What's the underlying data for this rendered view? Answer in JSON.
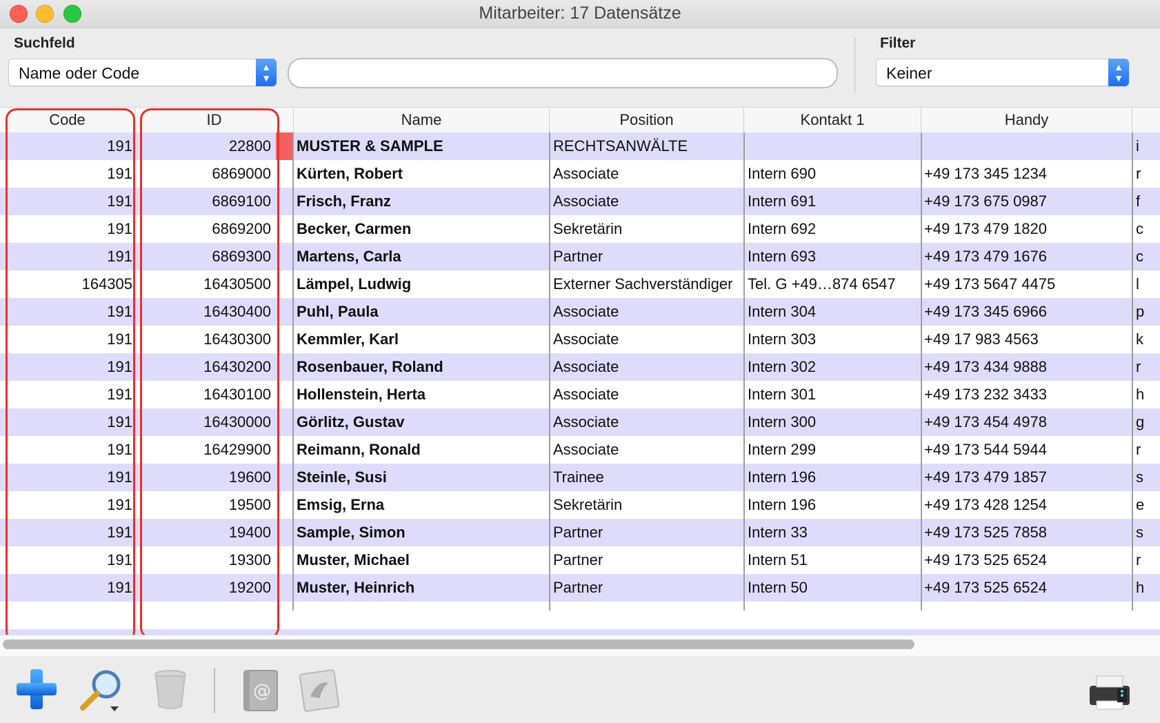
{
  "window": {
    "title": "Mitarbeiter: 17 Datensätze"
  },
  "search": {
    "field_label": "Suchfeld",
    "field_select": "Name oder Code",
    "query": "",
    "filter_label": "Filter",
    "filter_select": "Keiner"
  },
  "table": {
    "columns": [
      "Code",
      "ID",
      "Name",
      "Position",
      "Kontakt 1",
      "Handy"
    ],
    "rows": [
      {
        "code": "191",
        "id": "22800",
        "name": "MUSTER & SAMPLE",
        "position": "RECHTSANWÄLTE",
        "kontakt1": "",
        "handy": "",
        "extra": "i"
      },
      {
        "code": "191",
        "id": "6869000",
        "name": "Kürten, Robert",
        "position": "Associate",
        "kontakt1": "Intern 690",
        "handy": "+49 173 345 1234",
        "extra": "r"
      },
      {
        "code": "191",
        "id": "6869100",
        "name": "Frisch, Franz",
        "position": "Associate",
        "kontakt1": "Intern 691",
        "handy": "+49 173 675 0987",
        "extra": "f"
      },
      {
        "code": "191",
        "id": "6869200",
        "name": "Becker, Carmen",
        "position": "Sekretärin",
        "kontakt1": "Intern 692",
        "handy": "+49 173 479 1820",
        "extra": "c"
      },
      {
        "code": "191",
        "id": "6869300",
        "name": "Martens, Carla",
        "position": "Partner",
        "kontakt1": "Intern 693",
        "handy": "+49 173 479 1676",
        "extra": "c"
      },
      {
        "code": "164305",
        "id": "16430500",
        "name": "Lämpel, Ludwig",
        "position": "Externer Sachverständiger",
        "kontakt1": "Tel. G +49…874 6547",
        "handy": "+49 173 5647 4475",
        "extra": "l"
      },
      {
        "code": "191",
        "id": "16430400",
        "name": "Puhl, Paula",
        "position": "Associate",
        "kontakt1": "Intern 304",
        "handy": "+49 173 345 6966",
        "extra": "p"
      },
      {
        "code": "191",
        "id": "16430300",
        "name": "Kemmler, Karl",
        "position": "Associate",
        "kontakt1": "Intern 303",
        "handy": "+49 17 983 4563",
        "extra": "k"
      },
      {
        "code": "191",
        "id": "16430200",
        "name": "Rosenbauer, Roland",
        "position": "Associate",
        "kontakt1": "Intern 302",
        "handy": "+49 173 434 9888",
        "extra": "r"
      },
      {
        "code": "191",
        "id": "16430100",
        "name": "Hollenstein, Herta",
        "position": "Associate",
        "kontakt1": "Intern 301",
        "handy": "+49 173 232 3433",
        "extra": "h"
      },
      {
        "code": "191",
        "id": "16430000",
        "name": "Görlitz, Gustav",
        "position": "Associate",
        "kontakt1": "Intern 300",
        "handy": "+49 173 454 4978",
        "extra": "g"
      },
      {
        "code": "191",
        "id": "16429900",
        "name": "Reimann, Ronald",
        "position": "Associate",
        "kontakt1": "Intern 299",
        "handy": "+49 173 544 5944",
        "extra": "r"
      },
      {
        "code": "191",
        "id": "19600",
        "name": "Steinle, Susi",
        "position": "Trainee",
        "kontakt1": "Intern 196",
        "handy": "+49 173 479 1857",
        "extra": "s"
      },
      {
        "code": "191",
        "id": "19500",
        "name": "Emsig, Erna",
        "position": "Sekretärin",
        "kontakt1": "Intern 196",
        "handy": "+49 173 428 1254",
        "extra": "e"
      },
      {
        "code": "191",
        "id": "19400",
        "name": "Sample, Simon",
        "position": "Partner",
        "kontakt1": "Intern 33",
        "handy": "+49 173 525 7858",
        "extra": "s"
      },
      {
        "code": "191",
        "id": "19300",
        "name": "Muster, Michael",
        "position": "Partner",
        "kontakt1": "Intern 51",
        "handy": "+49 173 525 6524",
        "extra": "r"
      },
      {
        "code": "191",
        "id": "19200",
        "name": "Muster, Heinrich",
        "position": "Partner",
        "kontakt1": "Intern 50",
        "handy": "+49 173 525 6524",
        "extra": "h"
      }
    ]
  },
  "toolbar": {
    "icons": [
      "add-icon",
      "search-icon",
      "trash-icon",
      "address-book-icon",
      "mail-icon",
      "printer-icon"
    ]
  },
  "colors": {
    "row_stripe": "#dedcfa",
    "highlight": "#e8302c",
    "record_marker": "#f26060",
    "accent": "#1b6ff0"
  }
}
